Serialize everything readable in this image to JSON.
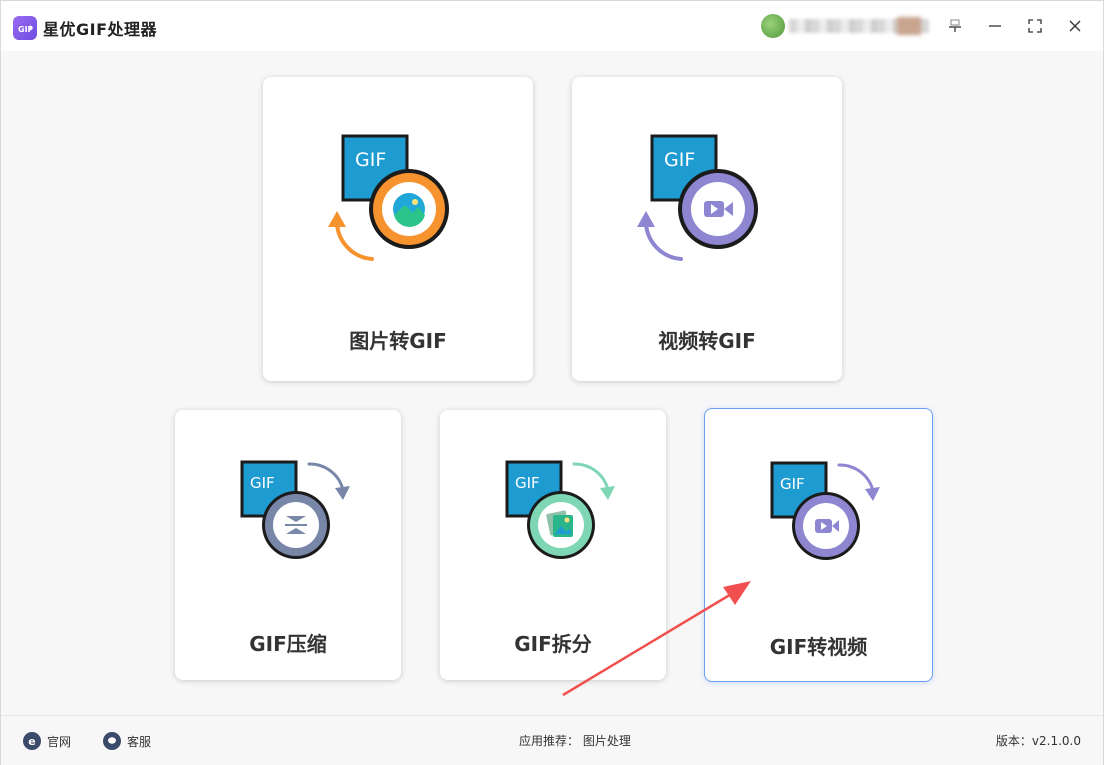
{
  "app": {
    "title": "星优GIF处理器"
  },
  "colors": {
    "accent_blue": "#1e9bd0",
    "orange": "#f7932e",
    "purple": "#8f86d2",
    "slate": "#7886a8",
    "mint": "#7fd6b5",
    "selected_border": "#6aa0f0",
    "annotation_red": "#f05050"
  },
  "cards": {
    "image_to_gif": {
      "label": "图片转GIF",
      "badge": "GIF"
    },
    "video_to_gif": {
      "label": "视频转GIF",
      "badge": "GIF"
    },
    "gif_compress": {
      "label": "GIF压缩",
      "badge": "GIF"
    },
    "gif_split": {
      "label": "GIF拆分",
      "badge": "GIF"
    },
    "gif_to_video": {
      "label": "GIF转视频",
      "badge": "GIF",
      "selected": true
    }
  },
  "footer": {
    "website": "官网",
    "support": "客服",
    "recommend_label": "应用推荐：",
    "recommend_value": "图片处理",
    "version_label": "版本：",
    "version_value": "v2.1.0.0"
  }
}
